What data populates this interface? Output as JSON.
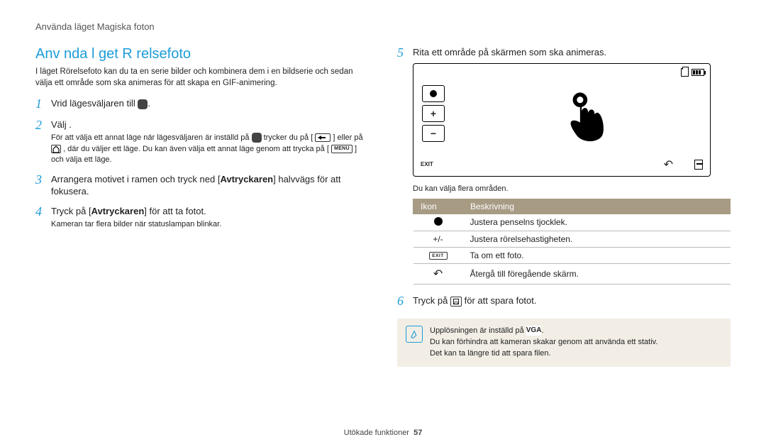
{
  "header": "Använda läget Magiska foton",
  "title": "Anv nda l get R relsefoto",
  "intro": "I läget Rörelsefoto kan du ta en serie bilder och kombinera dem i en bildserie och sedan välja ett område som ska animeras för att skapa en GIF-animering.",
  "steps_left": [
    {
      "n": "1",
      "main_prefix": "Vrid lägesväljaren till ",
      "main_suffix": "."
    },
    {
      "n": "2",
      "main_prefix": "Välj ",
      "main_suffix": ".",
      "sub_parts": [
        "För att välja ett annat läge när lägesväljaren är inställd på ",
        " trycker du på [",
        "] eller på ",
        ", där du väljer ett läge. Du kan även välja ett annat läge genom att trycka på [",
        "] och välja ett läge."
      ]
    },
    {
      "n": "3",
      "main_prefix": "Arrangera motivet i ramen och tryck ned [",
      "main_bold": "Avtryckaren",
      "main_suffix": "] halvvägs för att fokusera."
    },
    {
      "n": "4",
      "main_prefix": "Tryck på [",
      "main_bold": "Avtryckaren",
      "main_suffix": "] för att ta fotot.",
      "sub": "Kameran tar flera bilder när statuslampan blinkar."
    }
  ],
  "steps_right": [
    {
      "n": "5",
      "main": "Rita ett område på skärmen som ska animeras."
    },
    {
      "n": "6",
      "main_prefix": "Tryck på ",
      "main_suffix": " för att spara fotot."
    }
  ],
  "screen_caption": "Du kan välja flera områden.",
  "screen_exit": "EXIT",
  "table": {
    "headers": [
      "Ikon",
      "Beskrivning"
    ],
    "rows": [
      {
        "icon": "dot",
        "desc": "Justera penselns tjocklek."
      },
      {
        "icon": "plusminus",
        "label": "+/-",
        "desc": "Justera rörelsehastigheten."
      },
      {
        "icon": "exit",
        "label": "EXIT",
        "desc": "Ta om ett foto."
      },
      {
        "icon": "undo",
        "desc": "Återgå till föregående skärm."
      }
    ]
  },
  "note": {
    "line1_prefix": "Upplösningen är inställd på ",
    "line1_bold": "VGA",
    "line1_suffix": ".",
    "line2": "Du kan förhindra att kameran skakar genom att använda ett stativ.",
    "line3": "Det kan ta längre tid att spara filen."
  },
  "menu_label": "MENU",
  "footer": {
    "text": "Utökade funktioner",
    "page": "57"
  }
}
